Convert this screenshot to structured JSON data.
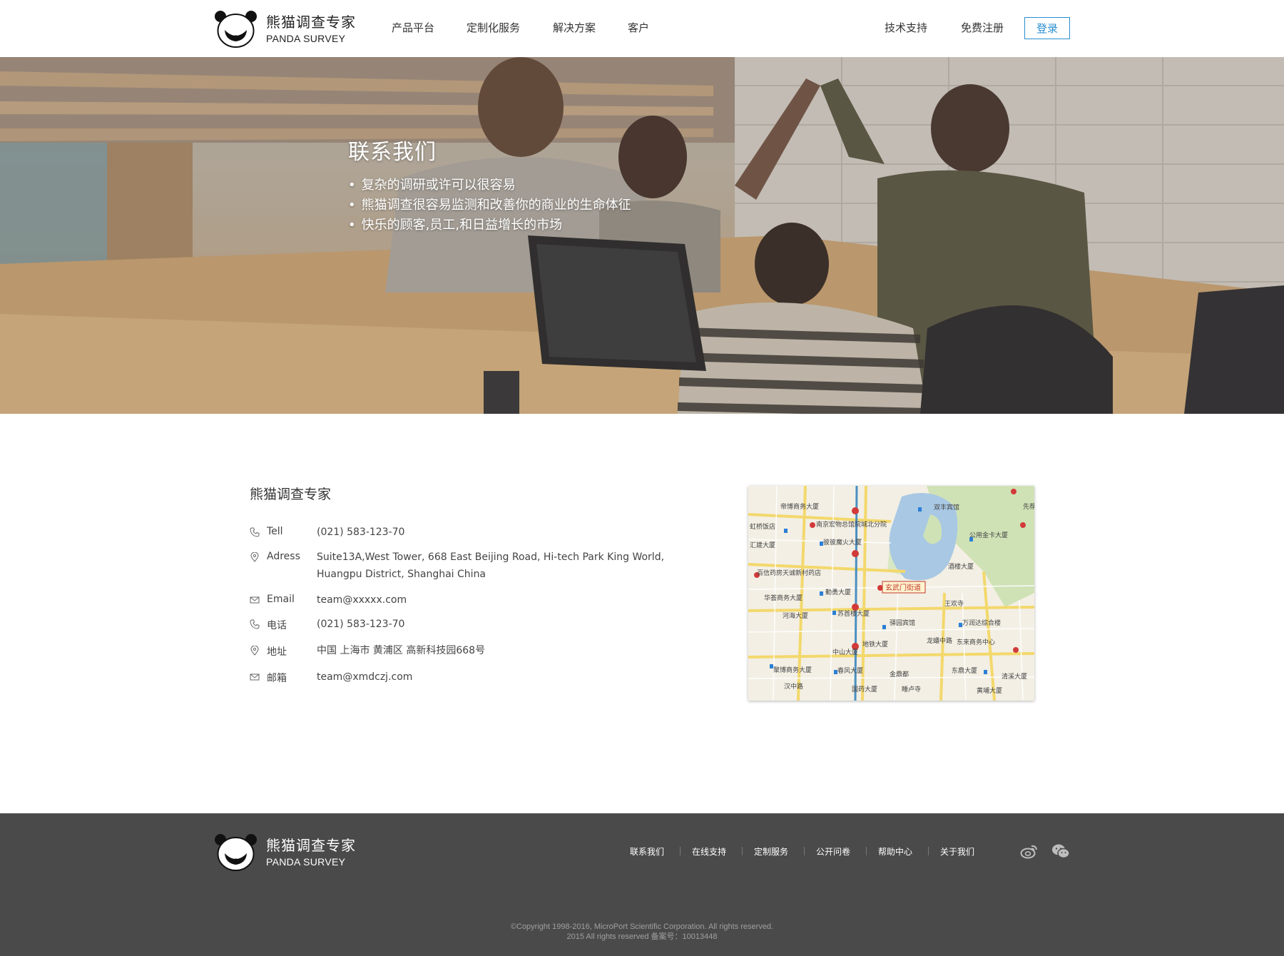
{
  "brand": {
    "name_cn": "熊猫调查专家",
    "name_en": "PANDA SURVEY"
  },
  "nav": {
    "items": [
      "产品平台",
      "定制化服务",
      "解决方案",
      "客户"
    ],
    "right": [
      "技术支持",
      "免费注册"
    ],
    "login": "登录"
  },
  "hero": {
    "title": "联系我们",
    "bullets": [
      "复杂的调研或许可以很容易",
      "熊猫调查很容易监测和改善你的商业的生命体征",
      "快乐的顾客,员工,和日益增长的市场"
    ]
  },
  "contact": {
    "company": "熊猫调查专家",
    "rows": [
      {
        "icon": "phone-icon",
        "label": "Tell",
        "value": "(021) 583-123-70"
      },
      {
        "icon": "location-pin-icon",
        "label": "Adress",
        "value": "Suite13A,West Tower, 668 East Beijing Road, Hi-tech Park King World,",
        "value2": "Huangpu  District, Shanghai China"
      },
      {
        "icon": "mail-icon",
        "label": "Email",
        "value": "team@xxxxx.com"
      },
      {
        "icon": "phone-icon",
        "label": "电话",
        "value": "(021) 583-123-70"
      },
      {
        "icon": "location-pin-icon",
        "label": "地址",
        "value": "中国 上海市 黄浦区 高新科技园668号"
      },
      {
        "icon": "mail-icon",
        "label": "邮箱",
        "value": "team@xmdczj.com"
      }
    ]
  },
  "map": {
    "labels": [
      "帝博商务大厦",
      "南京宏物总馆",
      "南京宏物总馆院城北分院",
      "双丰宾馆",
      "先荐",
      "公用金卡大厦",
      "虹桥饭店",
      "汇建大厦",
      "彼彼魔火大厦",
      "百信药房天诚新村药店",
      "酒楼大厦",
      "勤勇大厦",
      "玄武门街道",
      "华荟商务大厦",
      "王欢寺",
      "河海大厦",
      "苏首楼大厦",
      "驿园宾馆",
      "万润达综合楼",
      "东来商务中心",
      "中山大厦",
      "地铁大厦",
      "聚博商务大厦",
      "春风大厦",
      "金鼎都",
      "东鼎大厦",
      "汉中路",
      "国药大厦",
      "睡卢寺",
      "黄埔大厦",
      "清溪大厦",
      "龙蟠中路",
      "国盛药店",
      "宴会宾馆"
    ],
    "highlight": "玄武门街道"
  },
  "footer": {
    "links": [
      "联系我们",
      "在线支持",
      "定制服务",
      "公开问卷",
      "帮助中心",
      "关于我们"
    ],
    "copyright1": "©Copyright 1998-2016, MicroPort Scientific Corporation. All rights reserved.",
    "copyright2": "2015 All rights reserved 备案号：10013448"
  },
  "colors": {
    "accent": "#2a8fd0",
    "footer_bg": "#4a4a4a"
  }
}
